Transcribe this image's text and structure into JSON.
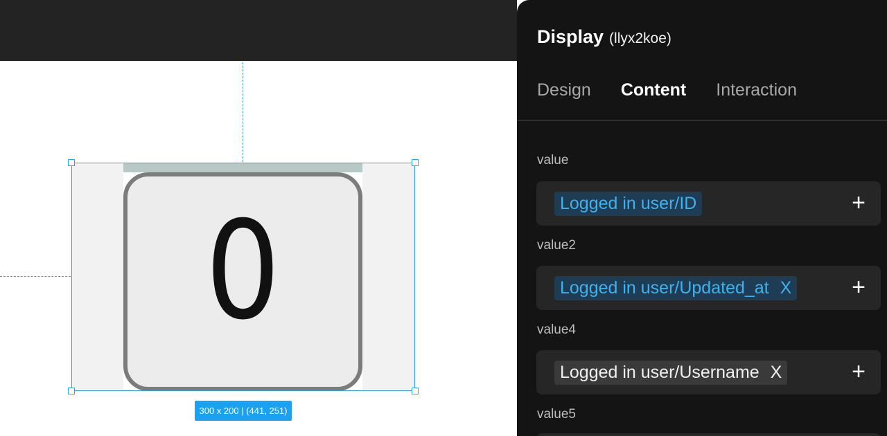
{
  "canvas": {
    "selection_info": "300 x 200 | (441, 251)",
    "widget_text": "0"
  },
  "panel": {
    "title": "Display",
    "element_id": "(llyx2koe)",
    "tabs": [
      {
        "label": "Design",
        "active": false
      },
      {
        "label": "Content",
        "active": true
      },
      {
        "label": "Interaction",
        "active": false
      }
    ],
    "fields": [
      {
        "label": "value",
        "chip": "Logged in user/ID",
        "chip_style": "blue",
        "removable": false
      },
      {
        "label": "value2",
        "chip": "Logged in user/Updated_at",
        "chip_style": "blue",
        "removable": true
      },
      {
        "label": "value4",
        "chip": "Logged in user/Username",
        "chip_style": "grey",
        "removable": true
      },
      {
        "label": "value5"
      }
    ],
    "remove_glyph": "X",
    "add_glyph": "+"
  },
  "colors": {
    "accent": "#1aa1f2",
    "panel_bg": "#141414",
    "chip_blue_text": "#3fb1ef"
  },
  "icons": [
    "plus-icon",
    "close-icon"
  ]
}
